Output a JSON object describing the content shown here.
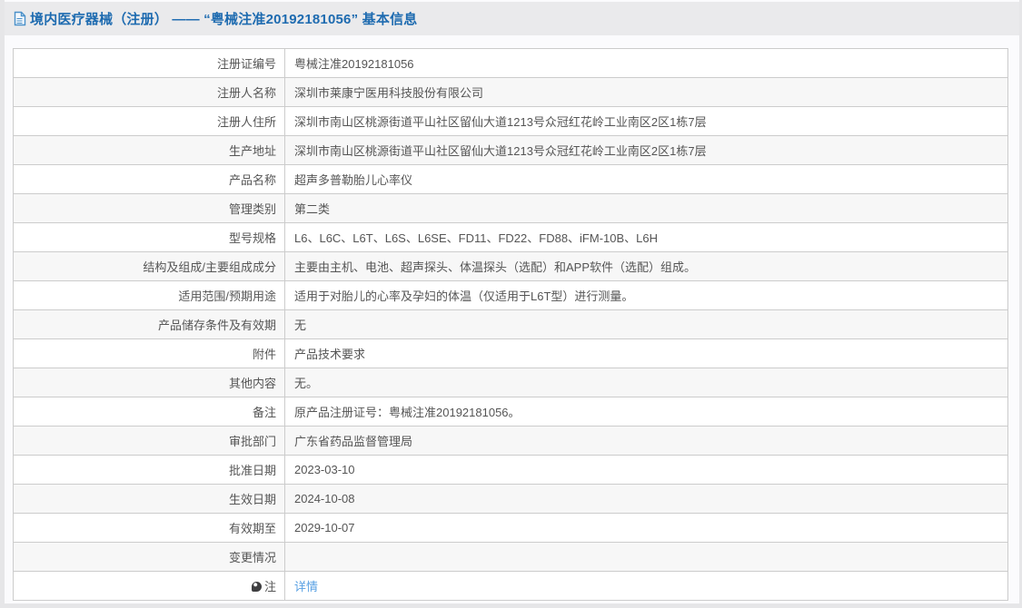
{
  "header": {
    "title": "境内医疗器械（注册） —— “粤械注准20192181056” 基本信息"
  },
  "colors": {
    "title_blue": "#1e6bb0",
    "link_blue": "#58a0e3",
    "icon_blue": "#4a90c9",
    "header_bar_bg": "#eaeaec",
    "row_alt_bg": "#f7f7f7",
    "border_gray": "#cccccc",
    "text_gray": "#555555"
  },
  "table": {
    "rows": [
      {
        "label": "注册证编号",
        "value": "粤械注准20192181056"
      },
      {
        "label": "注册人名称",
        "value": "深圳市莱康宁医用科技股份有限公司"
      },
      {
        "label": "注册人住所",
        "value": "深圳市南山区桃源街道平山社区留仙大道1213号众冠红花岭工业南区2区1栋7层"
      },
      {
        "label": "生产地址",
        "value": "深圳市南山区桃源街道平山社区留仙大道1213号众冠红花岭工业南区2区1栋7层"
      },
      {
        "label": "产品名称",
        "value": "超声多普勒胎儿心率仪"
      },
      {
        "label": "管理类别",
        "value": "第二类"
      },
      {
        "label": "型号规格",
        "value": "L6、L6C、L6T、L6S、L6SE、FD11、FD22、FD88、iFM-10B、L6H"
      },
      {
        "label": "结构及组成/主要组成成分",
        "value": "主要由主机、电池、超声探头、体温探头（选配）和APP软件（选配）组成。"
      },
      {
        "label": "适用范围/预期用途",
        "value": "适用于对胎儿的心率及孕妇的体温（仅适用于L6T型）进行测量。"
      },
      {
        "label": "产品储存条件及有效期",
        "value": "无"
      },
      {
        "label": "附件",
        "value": "产品技术要求"
      },
      {
        "label": "其他内容",
        "value": "无。"
      },
      {
        "label": "备注",
        "value": "原产品注册证号：粤械注准20192181056。"
      },
      {
        "label": "审批部门",
        "value": "广东省药品监督管理局"
      },
      {
        "label": "批准日期",
        "value": "2023-03-10"
      },
      {
        "label": "生效日期",
        "value": "2024-10-08"
      },
      {
        "label": "有效期至",
        "value": "2029-10-07"
      },
      {
        "label": "变更情况",
        "value": ""
      },
      {
        "label": "注",
        "value": "详情",
        "icon": "note-icon",
        "link": true
      }
    ]
  }
}
